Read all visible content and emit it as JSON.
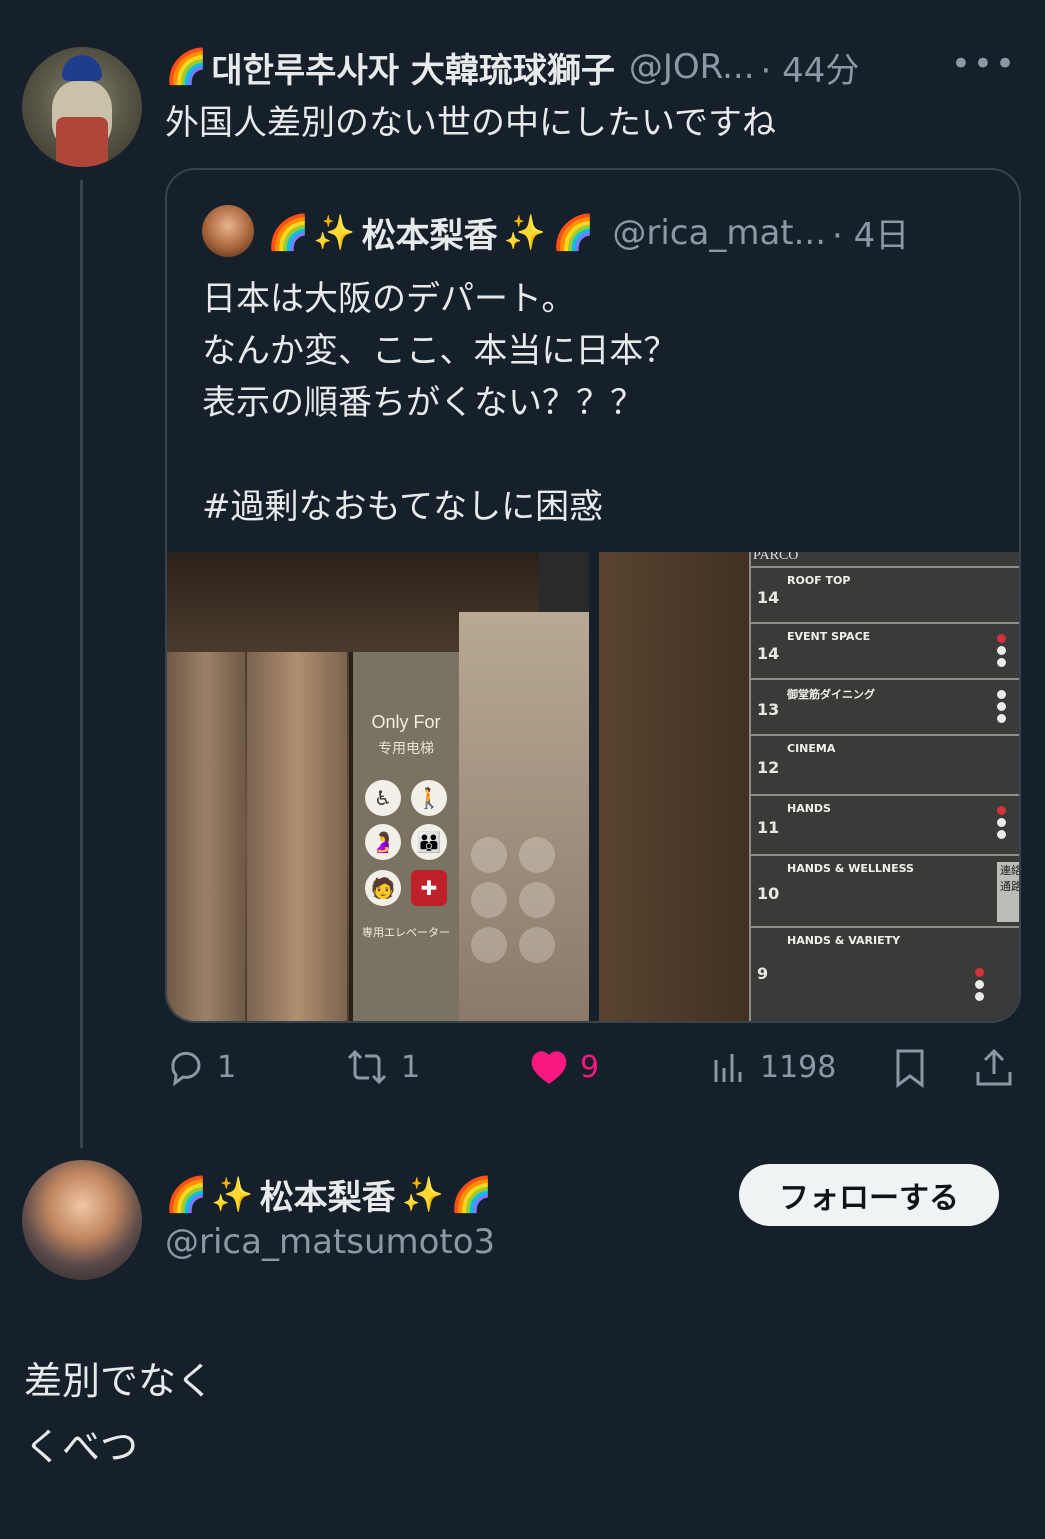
{
  "tweet1": {
    "display_name": "대한루추사자 大韓琉球獅子",
    "handle": "@JOR...",
    "time": "· 44分",
    "more_glyph": "•••",
    "text": "外国人差別のない世の中にしたいですね"
  },
  "quote": {
    "display_name": "松本梨香",
    "handle": "@rica_mat...",
    "time": "· 4日",
    "lines": [
      "日本は大阪のデパート。",
      "なんか変、ここ、本当に日本？",
      "表示の順番ちがくない？？？",
      "",
      "#過剰なおもてなしに困惑"
    ],
    "image_left": {
      "sign_title": "Only For",
      "sign_sub": "专用电梯",
      "sign_footer": "専用エレベーター"
    },
    "image_right": {
      "header": "PARCO",
      "floors": [
        {
          "num": "14",
          "name": "ROOF TOP"
        },
        {
          "num": "14",
          "name": "EVENT SPACE"
        },
        {
          "num": "13",
          "name": "御堂筋ダイニング"
        },
        {
          "num": "12",
          "name": "CINEMA"
        },
        {
          "num": "11",
          "name": "HANDS"
        },
        {
          "num": "10",
          "name": "HANDS & WELLNESS"
        },
        {
          "num": "9",
          "name": "HANDS & VARIETY"
        }
      ],
      "side_label": "連絡通路"
    }
  },
  "actions": {
    "reply_count": "1",
    "retweet_count": "1",
    "like_count": "9",
    "views_count": "1198"
  },
  "tweet2": {
    "display_name": "松本梨香",
    "handle": "@rica_matsumoto3",
    "follow_label": "フォローする",
    "lines": [
      "差別でなく",
      "くべつ"
    ]
  },
  "colors": {
    "background": "#15202b",
    "text": "#e7e9ea",
    "secondary": "#8b98a5",
    "like": "#f91880",
    "border": "#38444d"
  }
}
